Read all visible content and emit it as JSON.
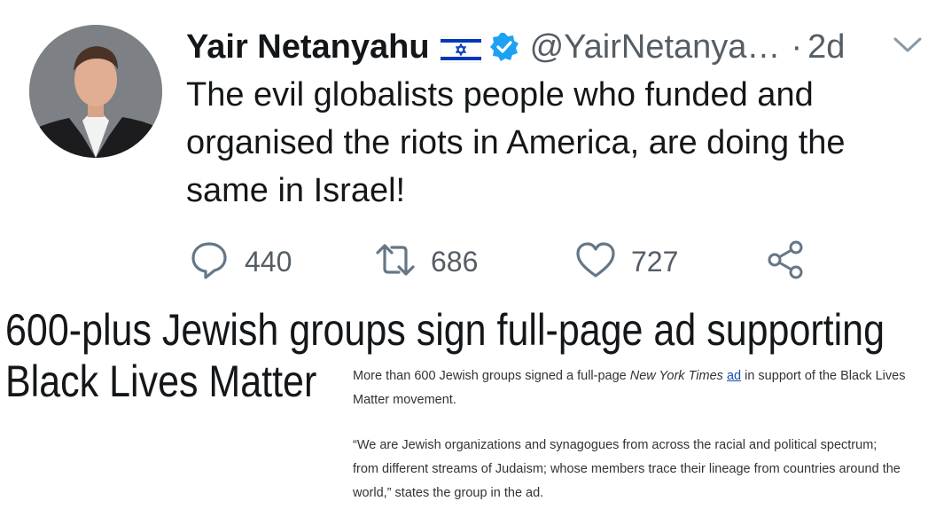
{
  "tweet": {
    "author_name": "Yair Netanyahu",
    "handle": "@YairNetanya…",
    "separator": "·",
    "time": "2d",
    "text": "The evil globalists people who funded and organised the riots in America, are doing the same in Israel!",
    "actions": {
      "replies": "440",
      "retweets": "686",
      "likes": "727"
    },
    "icons": {
      "flag": "israel-flag-icon",
      "verified": "verified-badge-icon",
      "menu": "chevron-down-icon",
      "reply": "comment-icon",
      "retweet": "retweet-icon",
      "like": "heart-icon",
      "share": "share-icon"
    },
    "colors": {
      "verified": "#1da1f2",
      "flag_blue": "#0038b8",
      "muted": "#555d65"
    }
  },
  "article": {
    "headline_line1": "600-plus Jewish groups sign full-page ad supporting",
    "headline_line2": "Black Lives Matter",
    "para1_before": "More than 600 Jewish groups signed a full-page ",
    "para1_italic": "New York Times",
    "para1_space": " ",
    "para1_link": "ad",
    "para1_after": " in support of the Black Lives Matter movement.",
    "para2": "“We are Jewish organizations and synagogues from across the racial and political spectrum; from different streams of Judaism; whose members trace their lineage from countries around the world,” states the group in the ad."
  }
}
